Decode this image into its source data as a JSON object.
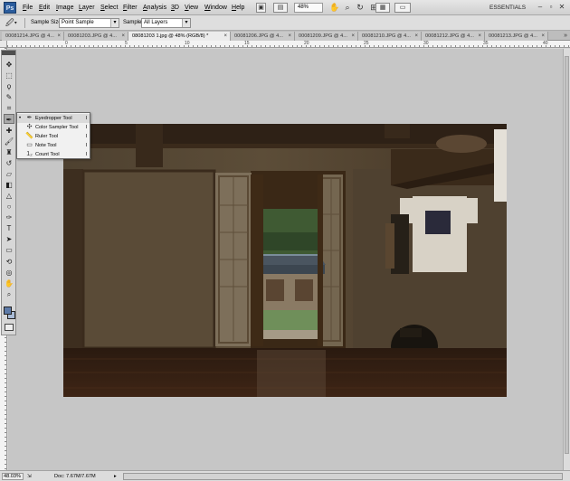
{
  "app": {
    "logo": "Ps"
  },
  "menubar": {
    "items": [
      "File",
      "Edit",
      "Image",
      "Layer",
      "Select",
      "Filter",
      "Analysis",
      "3D",
      "View",
      "Window",
      "Help"
    ],
    "zoom": "48%",
    "workspace": "ESSENTIALS"
  },
  "options": {
    "sample_size_label": "Sample Size:",
    "sample_size_value": "Point Sample",
    "sample_label": "Sample:",
    "sample_value": "All Layers"
  },
  "tabs": [
    {
      "label": "00081214.JPG @ 4...",
      "active": false
    },
    {
      "label": "00081203.JPG @ 4...",
      "active": false
    },
    {
      "label": "08081203 1.jpg @ 48% (RGB/8) *",
      "active": true
    },
    {
      "label": "00081206.JPG @ 4...",
      "active": false
    },
    {
      "label": "00081209.JPG @ 4...",
      "active": false
    },
    {
      "label": "00081210.JPG @ 4...",
      "active": false
    },
    {
      "label": "00081212.JPG @ 4...",
      "active": false
    },
    {
      "label": "00081213.JPG @ 4...",
      "active": false
    }
  ],
  "ruler": {
    "labels": [
      "0",
      "5",
      "10",
      "15",
      "20",
      "25",
      "30",
      "35",
      "40"
    ]
  },
  "flyout": {
    "items": [
      {
        "label": "Eyedropper Tool",
        "shortcut": "I",
        "selected": true,
        "icon": "eyedropper-icon"
      },
      {
        "label": "Color Sampler Tool",
        "shortcut": "I",
        "selected": false,
        "icon": "color-sampler-icon"
      },
      {
        "label": "Ruler Tool",
        "shortcut": "I",
        "selected": false,
        "icon": "ruler-icon"
      },
      {
        "label": "Note Tool",
        "shortcut": "I",
        "selected": false,
        "icon": "note-icon"
      },
      {
        "label": "Count Tool",
        "shortcut": "I",
        "selected": false,
        "icon": "count-icon"
      }
    ]
  },
  "status": {
    "zoom": "48.03%",
    "doc": "Doc: 7.67M/7.67M"
  },
  "colors": {
    "foreground": "#5d7aa8",
    "background": "#a9bbd6",
    "ps_blue": "#2b5c9c"
  }
}
